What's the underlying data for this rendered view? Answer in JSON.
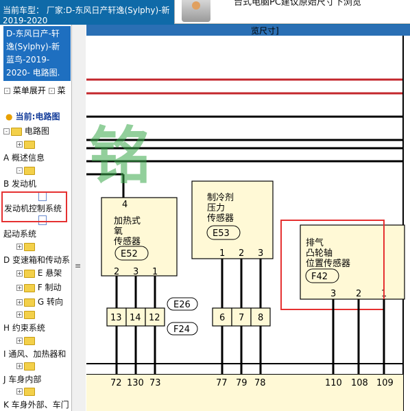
{
  "header": {
    "line1": "当前车型：  厂家:D-东风日产轩逸(Sylphy)-新",
    "line2": "2019-2020"
  },
  "popup": {
    "message": "台式电脑PC建议原始尺寸下浏览",
    "diagram_hint": "览尺寸]"
  },
  "sidebar": {
    "title_lines": [
      "D-东风日产-轩",
      "逸(Sylphy)-新",
      "蓝鸟-2019-",
      "2020- 电路图."
    ],
    "menu_expand": "菜单展开",
    "menu_collapse": "菜",
    "current": "当前:电路图",
    "tree": [
      "电路图",
      "A 概述信息",
      "B 发动机",
      "发动机控制系统",
      "起动系统",
      "D 变速箱和传动系",
      "E 悬架",
      "F 制动",
      "G 转向",
      "H 约束系统",
      "I 通风、加热器和",
      "J 车身内部",
      "K 车身外部、车门"
    ]
  },
  "diagram": {
    "e52": {
      "pin_top": "4",
      "label": [
        "加热式",
        "氧",
        "传感器"
      ],
      "code": "E52",
      "pins": [
        "2",
        "3",
        "1"
      ]
    },
    "e53": {
      "label": [
        "制冷剂",
        "压力",
        "传感器"
      ],
      "code": "E53",
      "pins": [
        "1",
        "2",
        "3"
      ]
    },
    "f42": {
      "label": [
        "排气",
        "凸轮轴",
        "位置传感器"
      ],
      "code": "F42",
      "pins": [
        "3",
        "2",
        "1"
      ]
    },
    "connector_left": {
      "pins": [
        "13",
        "14",
        "12"
      ],
      "tags": [
        "E26",
        "F24"
      ]
    },
    "connector_mid": {
      "pins": [
        "6",
        "7",
        "8"
      ]
    },
    "bottom_numbers": [
      "72",
      "130",
      "73",
      "77",
      "79",
      "78",
      "110",
      "108",
      "109"
    ],
    "watermark": "铭",
    "colors": {
      "red": "#c3262b",
      "yellow": "#fff9d6",
      "highlight": "#e53030",
      "watermark": "#3aa84a"
    }
  }
}
